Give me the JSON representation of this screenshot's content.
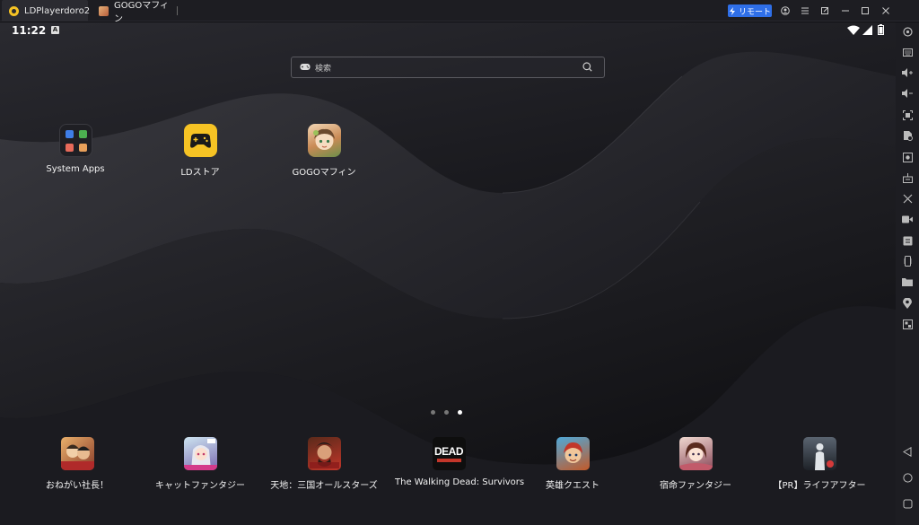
{
  "titlebar": {
    "tabs": [
      {
        "label": "LDPlayerdoro2",
        "active": true
      },
      {
        "label": "GOGOマフィン",
        "active": false
      }
    ],
    "remote_label": "リモート",
    "icons": [
      "user-icon",
      "menu-icon",
      "restore-icon",
      "minimize-icon",
      "maximize-icon",
      "close-icon"
    ]
  },
  "statusbar": {
    "time": "11:22",
    "badge": "A",
    "icons": [
      "wifi-icon",
      "signal-icon",
      "battery-icon"
    ]
  },
  "search": {
    "placeholder": "検索"
  },
  "home_apps": [
    {
      "label": "System Apps"
    },
    {
      "label": "LDストア"
    },
    {
      "label": "GOGOマフィン"
    }
  ],
  "page_indicator": {
    "count": 3,
    "active_index": 2
  },
  "dock": [
    {
      "label": "おねがい社長！"
    },
    {
      "label": "キャットファンタジー"
    },
    {
      "label": "天地：三国オールスターズ"
    },
    {
      "label": "The Walking Dead: Survivors",
      "icon_text": "DEAD"
    },
    {
      "label": "英雄クエスト"
    },
    {
      "label": "宿命ファンタジー"
    },
    {
      "label": "【PR】ライフアフター"
    }
  ],
  "sidebar": {
    "icons": [
      "settings-icon",
      "keyboard-icon",
      "volume-up-icon",
      "volume-down-icon",
      "screenshot-icon",
      "add-apk-icon",
      "record-icon",
      "operation-icon",
      "scissors-icon",
      "video-icon",
      "sync-icon",
      "shake-icon",
      "folder-icon",
      "location-icon",
      "multi-instance-icon",
      "back-icon",
      "home-icon",
      "recents-icon"
    ]
  },
  "colors": {
    "accent": "#2f6fe8",
    "ldstore_yellow": "#f6c324",
    "background": "#17171b"
  }
}
